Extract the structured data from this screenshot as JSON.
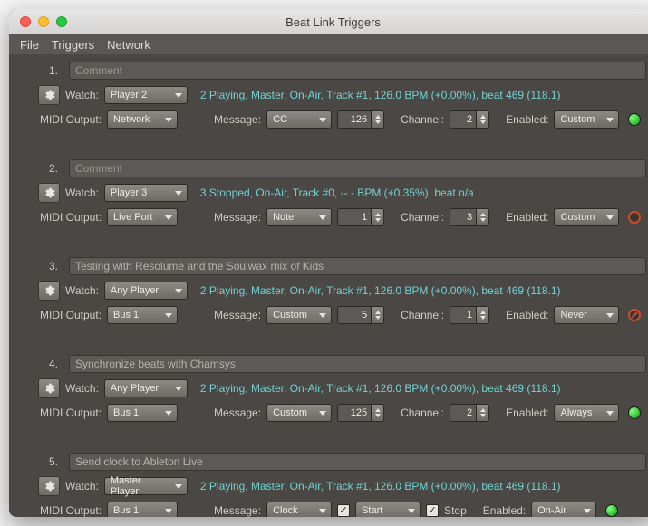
{
  "window": {
    "title": "Beat Link Triggers"
  },
  "menubar": [
    "File",
    "Triggers",
    "Network"
  ],
  "labels": {
    "watch": "Watch:",
    "midi_output": "MIDI Output:",
    "message": "Message:",
    "channel": "Channel:",
    "enabled": "Enabled:",
    "stop": "Stop",
    "comment_placeholder": "Comment"
  },
  "triggers": [
    {
      "index": "1.",
      "comment": "",
      "watch": "Player 2",
      "status": "2 Playing, Master, On-Air, Track #1, 126.0 BPM (+0.00%), beat 469 (118.1)",
      "midi_output": "Network",
      "message_type": "CC",
      "message_value": "126",
      "channel": "2",
      "enabled": "Custom",
      "led": "green",
      "clock_mode": false
    },
    {
      "index": "2.",
      "comment": "",
      "watch": "Player 3",
      "status": "3 Stopped, On-Air, Track #0, --.- BPM (+0.35%), beat n/a",
      "midi_output": "Live Port",
      "message_type": "Note",
      "message_value": "1",
      "channel": "3",
      "enabled": "Custom",
      "led": "redring",
      "clock_mode": false
    },
    {
      "index": "3.",
      "comment": "Testing with Resolume and the Soulwax mix of Kids",
      "watch": "Any Player",
      "status": "2 Playing, Master, On-Air, Track #1, 126.0 BPM (+0.00%), beat 469 (118.1)",
      "midi_output": "Bus 1",
      "message_type": "Custom",
      "message_value": "5",
      "channel": "1",
      "enabled": "Never",
      "led": "redslash",
      "clock_mode": false
    },
    {
      "index": "4.",
      "comment": "Synchronize beats with Chamsys",
      "watch": "Any Player",
      "status": "2 Playing, Master, On-Air, Track #1, 126.0 BPM (+0.00%), beat 469 (118.1)",
      "midi_output": "Bus 1",
      "message_type": "Custom",
      "message_value": "125",
      "channel": "2",
      "enabled": "Always",
      "led": "green",
      "clock_mode": false
    },
    {
      "index": "5.",
      "comment": "Send clock to Ableton Live",
      "watch": "Master Player",
      "status": "2 Playing, Master, On-Air, Track #1, 126.0 BPM (+0.00%), beat 469 (118.1)",
      "midi_output": "Bus 1",
      "message_type": "Clock",
      "clock_start_checked": true,
      "clock_start_label": "Start",
      "clock_stop_checked": true,
      "enabled": "On-Air",
      "led": "green",
      "clock_mode": true
    }
  ]
}
